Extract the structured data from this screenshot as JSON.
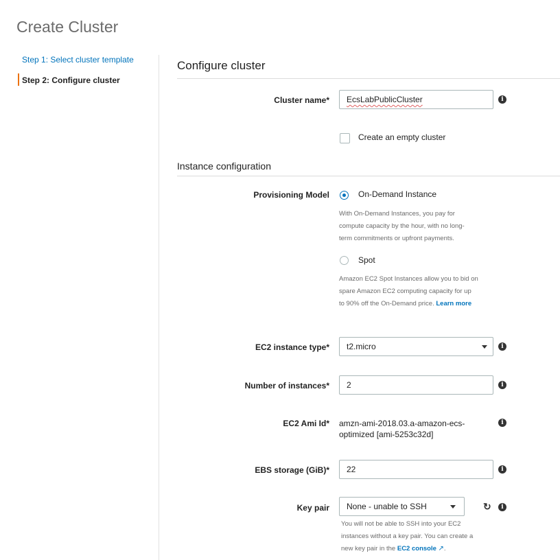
{
  "page": {
    "title": "Create Cluster"
  },
  "steps": {
    "step1": "Step 1: Select cluster template",
    "step2": "Step 2: Configure cluster"
  },
  "section": {
    "title": "Configure cluster",
    "instance_title": "Instance configuration"
  },
  "cluster_name": {
    "label": "Cluster name*",
    "value": "EcsLabPublicCluster"
  },
  "empty_cluster": {
    "label": "Create an empty cluster",
    "checked": false
  },
  "provisioning": {
    "label": "Provisioning Model",
    "on_demand": {
      "label": "On-Demand Instance",
      "selected": true,
      "help_lines": [
        "With On-Demand Instances, you pay for",
        "compute capacity by the hour, with no long-",
        "term commitments or upfront payments."
      ]
    },
    "spot": {
      "label": "Spot",
      "selected": false,
      "help_lines": [
        "Amazon EC2 Spot Instances allow you to bid on",
        "spare Amazon EC2 computing capacity for up",
        "to 90% off the On-Demand price."
      ],
      "learn_more": "Learn more"
    }
  },
  "instance_type": {
    "label": "EC2 instance type*",
    "value": "t2.micro"
  },
  "num_instances": {
    "label": "Number of instances*",
    "value": "2"
  },
  "ami": {
    "label": "EC2 Ami Id*",
    "line1": "amzn-ami-2018.03.a-amazon-ecs-",
    "line2": "optimized [ami-5253c32d]"
  },
  "ebs": {
    "label": "EBS storage (GiB)*",
    "value": "22"
  },
  "key_pair": {
    "label": "Key pair",
    "value": "None - unable to SSH",
    "help_lines": [
      "You will not be able to SSH into your EC2",
      "instances without a key pair. You can create a"
    ],
    "help_line3_prefix": "new key pair in the",
    "console_link": "EC2 console",
    "help_line3_suffix": "."
  },
  "icons": {
    "info": "info-icon",
    "refresh": "refresh-icon",
    "external": "external-link-icon",
    "caret": "chevron-down-icon"
  },
  "colors": {
    "accent": "#0073bb",
    "step_marker": "#ec7211"
  }
}
